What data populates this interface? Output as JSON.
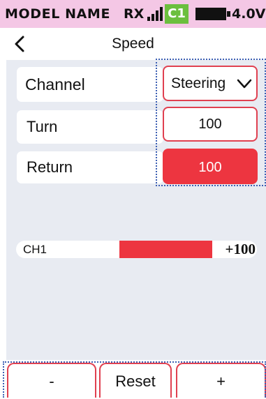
{
  "status_bar": {
    "model_name": "MODEL NAME",
    "receiver_label": "RX",
    "signal_icon": "signal-bars-icon",
    "channel_badge": "C1",
    "battery_icon": "battery-icon",
    "voltage": "4.0V",
    "background_color": "#f4c7e5",
    "badge_color": "#6cbf3e"
  },
  "header": {
    "back_icon": "chevron-left-icon",
    "title": "Speed"
  },
  "settings": {
    "channel": {
      "label": "Channel",
      "value": "Steering",
      "dropdown_icon": "chevron-down-icon"
    },
    "turn": {
      "label": "Turn",
      "value": "100"
    },
    "return": {
      "label": "Return",
      "value": "100"
    }
  },
  "output": {
    "channel_label": "CH1",
    "value_text": "+100",
    "value": 100,
    "range": [
      -100,
      100
    ]
  },
  "buttons": {
    "minus": "-",
    "reset": "Reset",
    "plus": "+"
  },
  "colors": {
    "accent": "#ed3540",
    "panel": "#e8ebf2",
    "focus_outline": "#3c5fb3"
  }
}
